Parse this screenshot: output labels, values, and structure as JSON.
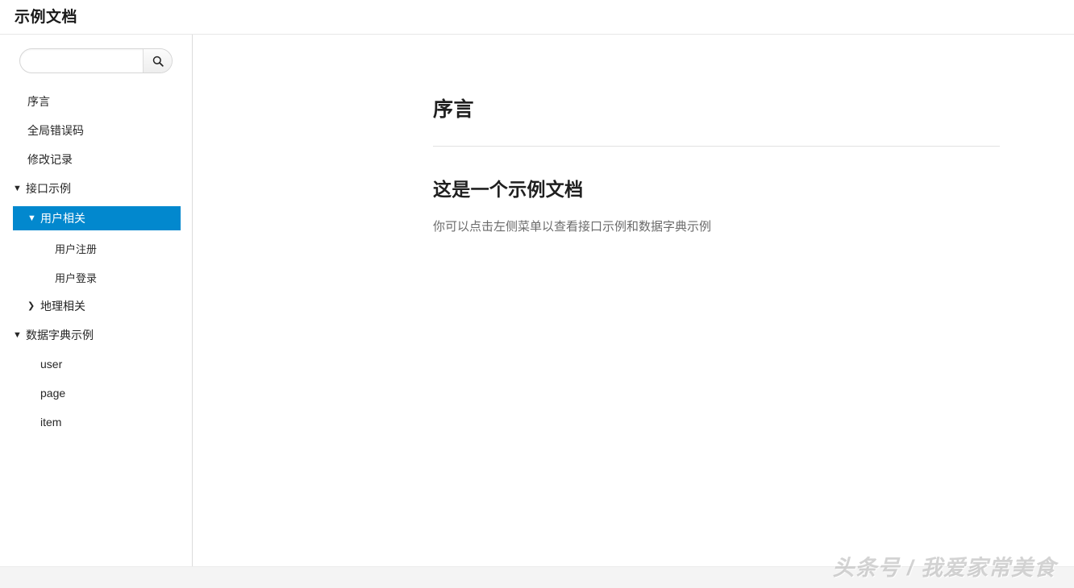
{
  "header": {
    "title": "示例文档"
  },
  "search": {
    "value": "",
    "placeholder": "",
    "icon": "search-icon",
    "button_label": ""
  },
  "sidebar": {
    "items": [
      {
        "label": "序言",
        "level": 1,
        "chevron": "",
        "active": false
      },
      {
        "label": "全局错误码",
        "level": 1,
        "chevron": "",
        "active": false
      },
      {
        "label": "修改记录",
        "level": 1,
        "chevron": "",
        "active": false
      },
      {
        "label": "接口示例",
        "level": 1,
        "chevron": "▼",
        "active": false
      },
      {
        "label": "用户相关",
        "level": 2,
        "chevron": "▼",
        "active": true
      },
      {
        "label": "用户注册",
        "level": 3,
        "chevron": "",
        "active": false
      },
      {
        "label": "用户登录",
        "level": 3,
        "chevron": "",
        "active": false
      },
      {
        "label": "地理相关",
        "level": 2,
        "chevron": "❯",
        "active": false
      },
      {
        "label": "数据字典示例",
        "level": 1,
        "chevron": "▼",
        "active": false
      },
      {
        "label": "user",
        "level": 2,
        "chevron": "",
        "active": false
      },
      {
        "label": "page",
        "level": 2,
        "chevron": "",
        "active": false
      },
      {
        "label": "item",
        "level": 2,
        "chevron": "",
        "active": false
      }
    ]
  },
  "main": {
    "doc_title": "序言",
    "section_title": "这是一个示例文档",
    "section_paragraph": "你可以点击左侧菜单以查看接口示例和数据字典示例"
  },
  "watermark": {
    "text": "头条号 / 我爱家常美食"
  },
  "colors": {
    "accent": "#0288ce",
    "sidebar_border": "#dcdcdc",
    "header_border": "#e8e8e8",
    "footer_bg": "#f4f4f4",
    "heading": "#1f1f1f",
    "paragraph": "#6b6b6b"
  }
}
